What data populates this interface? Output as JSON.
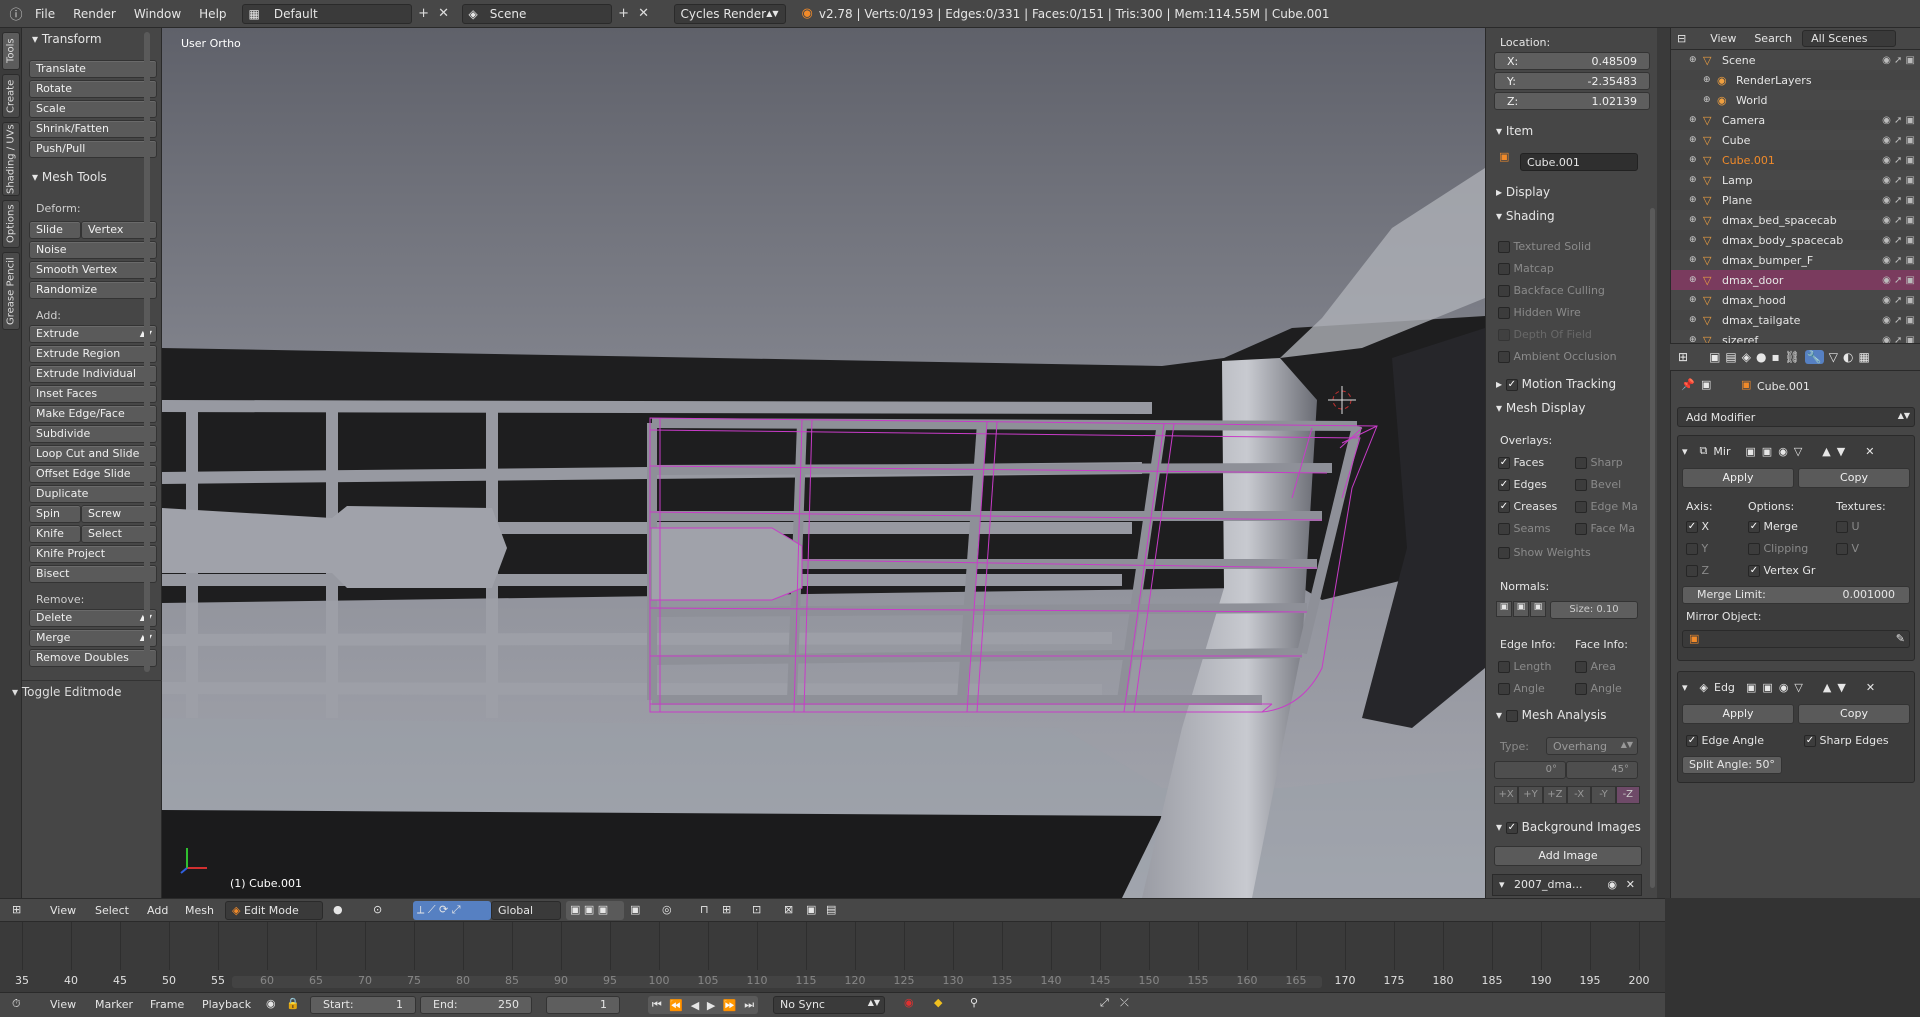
{
  "header": {
    "menus": [
      "File",
      "Render",
      "Window",
      "Help"
    ],
    "layout": "Default",
    "scene": "Scene",
    "engine": "Cycles Render",
    "stats": "v2.78 | Verts:0/193 | Edges:0/331 | Faces:0/151 | Tris:300 | Mem:114.55M | Cube.001"
  },
  "toolshelf": {
    "tabs": [
      "Tools",
      "Create",
      "Shading / UVs",
      "Options",
      "Grease Pencil"
    ],
    "transform_title": "Transform",
    "transform_buttons": [
      "Translate",
      "Rotate",
      "Scale",
      "Shrink/Fatten",
      "Push/Pull"
    ],
    "mesh_tools_title": "Mesh Tools",
    "deform_label": "Deform:",
    "slide_edge": "Slide Ed",
    "vertex": "Vertex",
    "noise": "Noise",
    "smooth_vertex": "Smooth Vertex",
    "randomize": "Randomize",
    "add_label": "Add:",
    "extrude": "Extrude",
    "extrude_region": "Extrude Region",
    "extrude_individual": "Extrude Individual",
    "inset_faces": "Inset Faces",
    "make_edge_face": "Make Edge/Face",
    "subdivide": "Subdivide",
    "loop_cut": "Loop Cut and Slide",
    "offset_edge": "Offset Edge Slide",
    "duplicate": "Duplicate",
    "spin": "Spin",
    "screw": "Screw",
    "knife": "Knife",
    "select": "Select",
    "knife_project": "Knife Project",
    "bisect": "Bisect",
    "remove_label": "Remove:",
    "delete": "Delete",
    "merge": "Merge",
    "remove_doubles": "Remove Doubles",
    "toggle_editmode": "Toggle Editmode"
  },
  "viewport": {
    "view_label": "User Ortho",
    "object_label": "(1) Cube.001"
  },
  "npanel": {
    "location_label": "Location:",
    "x_label": "X:",
    "x": "0.48509",
    "y_label": "Y:",
    "y": "-2.35483",
    "z_label": "Z:",
    "z": "1.02139",
    "item_title": "Item",
    "item_name": "Cube.001",
    "display_title": "Display",
    "shading_title": "Shading",
    "shading_options": [
      "Textured Solid",
      "Matcap",
      "Backface Culling",
      "Hidden Wire",
      "Depth Of Field",
      "Ambient Occlusion"
    ],
    "motion_tracking": "Motion Tracking",
    "mesh_display": "Mesh Display",
    "overlays_label": "Overlays:",
    "faces": "Faces",
    "sharp": "Sharp",
    "edges": "Edges",
    "bevel": "Bevel",
    "creases": "Creases",
    "edge_ma": "Edge Ma",
    "seams": "Seams",
    "face_ma": "Face Ma",
    "show_weights": "Show Weights",
    "normals_label": "Normals:",
    "size": "Size:  0.10",
    "edge_info": "Edge Info:",
    "face_info": "Face Info:",
    "length": "Length",
    "area": "Area",
    "angle": "Angle",
    "angle2": "Angle",
    "mesh_analysis": "Mesh Analysis",
    "type_label": "Type:",
    "type_value": "Overhang",
    "range_min": "0°",
    "range_max": "45°",
    "axes": [
      "+X",
      "+Y",
      "+Z",
      "-X",
      "-Y",
      "-Z"
    ],
    "background_images": "Background Images",
    "add_image": "Add Image",
    "bg_image_name": "2007_dma..."
  },
  "outliner": {
    "view": "View",
    "search": "Search",
    "filter": "All Scenes",
    "items": [
      {
        "name": "Scene",
        "indent": 0
      },
      {
        "name": "RenderLayers",
        "indent": 1
      },
      {
        "name": "World",
        "indent": 1
      },
      {
        "name": "Camera",
        "indent": 0
      },
      {
        "name": "Cube",
        "indent": 0
      },
      {
        "name": "Cube.001",
        "indent": 0,
        "active": true
      },
      {
        "name": "Lamp",
        "indent": 0
      },
      {
        "name": "Plane",
        "indent": 0
      },
      {
        "name": "dmax_bed_spacecab",
        "indent": 0
      },
      {
        "name": "dmax_body_spacecab",
        "indent": 0
      },
      {
        "name": "dmax_bumper_F",
        "indent": 0
      },
      {
        "name": "dmax_door",
        "indent": 0,
        "selected": true
      },
      {
        "name": "dmax_hood",
        "indent": 0
      },
      {
        "name": "dmax_tailgate",
        "indent": 0
      },
      {
        "name": "sizeref",
        "indent": 0
      }
    ]
  },
  "properties": {
    "object_name": "Cube.001",
    "add_modifier": "Add Modifier",
    "mirror": {
      "name": "Mir",
      "apply": "Apply",
      "copy": "Copy",
      "axis_label": "Axis:",
      "options_label": "Options:",
      "textures_label": "Textures:",
      "x": "X",
      "y": "Y",
      "z": "Z",
      "merge": "Merge",
      "clipping": "Clipping",
      "vertex_groups": "Vertex Gr",
      "u": "U",
      "v": "V",
      "merge_limit_label": "Merge Limit:",
      "merge_limit": "0.001000",
      "mirror_object": "Mirror Object:"
    },
    "edge_split": {
      "name": "Edg",
      "apply": "Apply",
      "copy": "Copy",
      "edge_angle": "Edge Angle",
      "sharp_edges": "Sharp Edges",
      "split_angle": "Split Angle: 50°"
    }
  },
  "view_header": {
    "menus": [
      "View",
      "Select",
      "Add",
      "Mesh"
    ],
    "mode": "Edit Mode",
    "orientation": "Global"
  },
  "timeline": {
    "ticks": [
      "35",
      "40",
      "45",
      "50",
      "55",
      "60",
      "65",
      "70",
      "75",
      "80",
      "85",
      "90",
      "95",
      "100",
      "105",
      "110",
      "115",
      "120",
      "125",
      "130",
      "135",
      "140",
      "145",
      "150",
      "155",
      "160",
      "165",
      "170",
      "175",
      "180",
      "185",
      "190",
      "195",
      "200"
    ],
    "menus": [
      "View",
      "Marker",
      "Frame",
      "Playback"
    ],
    "start_label": "Start:",
    "start": "1",
    "end_label": "End:",
    "end": "250",
    "current": "1",
    "sync": "No Sync"
  },
  "colors": {
    "wire": "#c83cc8",
    "active_object": "#f08a2a",
    "selected_row": "#7a3b5e"
  }
}
